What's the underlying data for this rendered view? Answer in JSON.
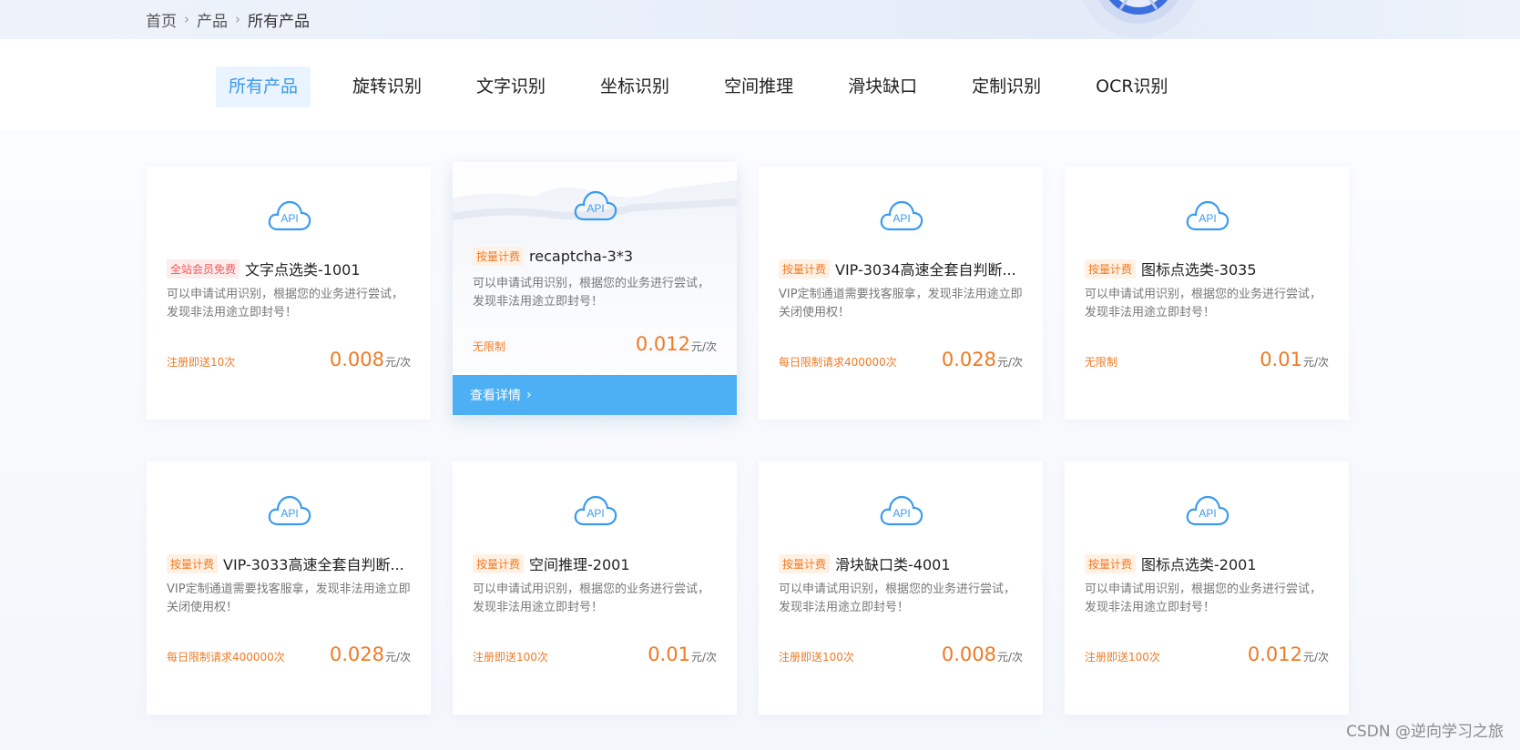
{
  "breadcrumb": [
    "首页",
    "产品",
    "所有产品"
  ],
  "tabs": [
    "所有产品",
    "旋转识别",
    "文字识别",
    "坐标识别",
    "空间推理",
    "滑块缺口",
    "定制识别",
    "OCR识别"
  ],
  "active_tab": "所有产品",
  "icon_text": "API",
  "detail_button": "查看详情",
  "colors": {
    "accent": "#3a98ec",
    "price": "#f07a24",
    "detail_bar": "#4db0f5"
  },
  "cards": [
    {
      "badge": "全站会员免费",
      "badge_type": "free",
      "name": "文字点选类-1001",
      "desc": "可以申请试用识别，根据您的业务进行尝试，发现非法用途立即封号！",
      "bonus": "注册即送10次",
      "price": "0.008",
      "unit": "元/次"
    },
    {
      "badge": "按量计费",
      "badge_type": "metered",
      "name": "recaptcha-3*3",
      "desc": "可以申请试用识别，根据您的业务进行尝试，发现非法用途立即封号！",
      "bonus": "无限制",
      "price": "0.012",
      "unit": "元/次"
    },
    {
      "badge": "按量计费",
      "badge_type": "metered",
      "name": "VIP-3034高速全套自判断...",
      "desc": "VIP定制通道需要找客服拿，发现非法用途立即关闭使用权！",
      "bonus": "每日限制请求400000次",
      "price": "0.028",
      "unit": "元/次"
    },
    {
      "badge": "按量计费",
      "badge_type": "metered",
      "name": "图标点选类-3035",
      "desc": "可以申请试用识别，根据您的业务进行尝试，发现非法用途立即封号！",
      "bonus": "无限制",
      "price": "0.01",
      "unit": "元/次"
    },
    {
      "badge": "按量计费",
      "badge_type": "metered",
      "name": "VIP-3033高速全套自判断...",
      "desc": "VIP定制通道需要找客服拿，发现非法用途立即关闭使用权！",
      "bonus": "每日限制请求400000次",
      "price": "0.028",
      "unit": "元/次"
    },
    {
      "badge": "按量计费",
      "badge_type": "metered",
      "name": "空间推理-2001",
      "desc": "可以申请试用识别，根据您的业务进行尝试，发现非法用途立即封号！",
      "bonus": "注册即送100次",
      "price": "0.01",
      "unit": "元/次"
    },
    {
      "badge": "按量计费",
      "badge_type": "metered",
      "name": "滑块缺口类-4001",
      "desc": "可以申请试用识别，根据您的业务进行尝试，发现非法用途立即封号！",
      "bonus": "注册即送100次",
      "price": "0.008",
      "unit": "元/次"
    },
    {
      "badge": "按量计费",
      "badge_type": "metered",
      "name": "图标点选类-2001",
      "desc": "可以申请试用识别，根据您的业务进行尝试，发现非法用途立即封号！",
      "bonus": "注册即送100次",
      "price": "0.012",
      "unit": "元/次"
    }
  ],
  "watermark": "CSDN @逆向学习之旅"
}
